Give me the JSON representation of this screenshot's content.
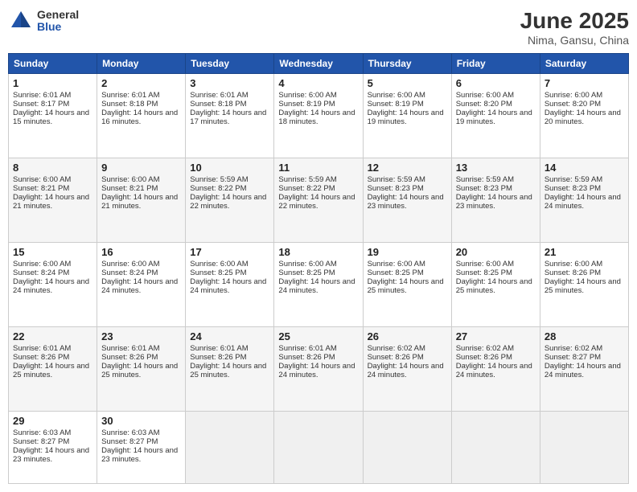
{
  "header": {
    "logo_general": "General",
    "logo_blue": "Blue",
    "month_title": "June 2025",
    "location": "Nima, Gansu, China"
  },
  "days_of_week": [
    "Sunday",
    "Monday",
    "Tuesday",
    "Wednesday",
    "Thursday",
    "Friday",
    "Saturday"
  ],
  "weeks": [
    [
      {
        "day": 1,
        "sunrise": "6:01 AM",
        "sunset": "8:17 PM",
        "daylight": "14 hours and 15 minutes."
      },
      {
        "day": 2,
        "sunrise": "6:01 AM",
        "sunset": "8:18 PM",
        "daylight": "14 hours and 16 minutes."
      },
      {
        "day": 3,
        "sunrise": "6:01 AM",
        "sunset": "8:18 PM",
        "daylight": "14 hours and 17 minutes."
      },
      {
        "day": 4,
        "sunrise": "6:00 AM",
        "sunset": "8:19 PM",
        "daylight": "14 hours and 18 minutes."
      },
      {
        "day": 5,
        "sunrise": "6:00 AM",
        "sunset": "8:19 PM",
        "daylight": "14 hours and 19 minutes."
      },
      {
        "day": 6,
        "sunrise": "6:00 AM",
        "sunset": "8:20 PM",
        "daylight": "14 hours and 19 minutes."
      },
      {
        "day": 7,
        "sunrise": "6:00 AM",
        "sunset": "8:20 PM",
        "daylight": "14 hours and 20 minutes."
      }
    ],
    [
      {
        "day": 8,
        "sunrise": "6:00 AM",
        "sunset": "8:21 PM",
        "daylight": "14 hours and 21 minutes."
      },
      {
        "day": 9,
        "sunrise": "6:00 AM",
        "sunset": "8:21 PM",
        "daylight": "14 hours and 21 minutes."
      },
      {
        "day": 10,
        "sunrise": "5:59 AM",
        "sunset": "8:22 PM",
        "daylight": "14 hours and 22 minutes."
      },
      {
        "day": 11,
        "sunrise": "5:59 AM",
        "sunset": "8:22 PM",
        "daylight": "14 hours and 22 minutes."
      },
      {
        "day": 12,
        "sunrise": "5:59 AM",
        "sunset": "8:23 PM",
        "daylight": "14 hours and 23 minutes."
      },
      {
        "day": 13,
        "sunrise": "5:59 AM",
        "sunset": "8:23 PM",
        "daylight": "14 hours and 23 minutes."
      },
      {
        "day": 14,
        "sunrise": "5:59 AM",
        "sunset": "8:23 PM",
        "daylight": "14 hours and 24 minutes."
      }
    ],
    [
      {
        "day": 15,
        "sunrise": "6:00 AM",
        "sunset": "8:24 PM",
        "daylight": "14 hours and 24 minutes."
      },
      {
        "day": 16,
        "sunrise": "6:00 AM",
        "sunset": "8:24 PM",
        "daylight": "14 hours and 24 minutes."
      },
      {
        "day": 17,
        "sunrise": "6:00 AM",
        "sunset": "8:25 PM",
        "daylight": "14 hours and 24 minutes."
      },
      {
        "day": 18,
        "sunrise": "6:00 AM",
        "sunset": "8:25 PM",
        "daylight": "14 hours and 24 minutes."
      },
      {
        "day": 19,
        "sunrise": "6:00 AM",
        "sunset": "8:25 PM",
        "daylight": "14 hours and 25 minutes."
      },
      {
        "day": 20,
        "sunrise": "6:00 AM",
        "sunset": "8:25 PM",
        "daylight": "14 hours and 25 minutes."
      },
      {
        "day": 21,
        "sunrise": "6:00 AM",
        "sunset": "8:26 PM",
        "daylight": "14 hours and 25 minutes."
      }
    ],
    [
      {
        "day": 22,
        "sunrise": "6:01 AM",
        "sunset": "8:26 PM",
        "daylight": "14 hours and 25 minutes."
      },
      {
        "day": 23,
        "sunrise": "6:01 AM",
        "sunset": "8:26 PM",
        "daylight": "14 hours and 25 minutes."
      },
      {
        "day": 24,
        "sunrise": "6:01 AM",
        "sunset": "8:26 PM",
        "daylight": "14 hours and 25 minutes."
      },
      {
        "day": 25,
        "sunrise": "6:01 AM",
        "sunset": "8:26 PM",
        "daylight": "14 hours and 24 minutes."
      },
      {
        "day": 26,
        "sunrise": "6:02 AM",
        "sunset": "8:26 PM",
        "daylight": "14 hours and 24 minutes."
      },
      {
        "day": 27,
        "sunrise": "6:02 AM",
        "sunset": "8:26 PM",
        "daylight": "14 hours and 24 minutes."
      },
      {
        "day": 28,
        "sunrise": "6:02 AM",
        "sunset": "8:27 PM",
        "daylight": "14 hours and 24 minutes."
      }
    ],
    [
      {
        "day": 29,
        "sunrise": "6:03 AM",
        "sunset": "8:27 PM",
        "daylight": "14 hours and 23 minutes."
      },
      {
        "day": 30,
        "sunrise": "6:03 AM",
        "sunset": "8:27 PM",
        "daylight": "14 hours and 23 minutes."
      },
      null,
      null,
      null,
      null,
      null
    ]
  ]
}
